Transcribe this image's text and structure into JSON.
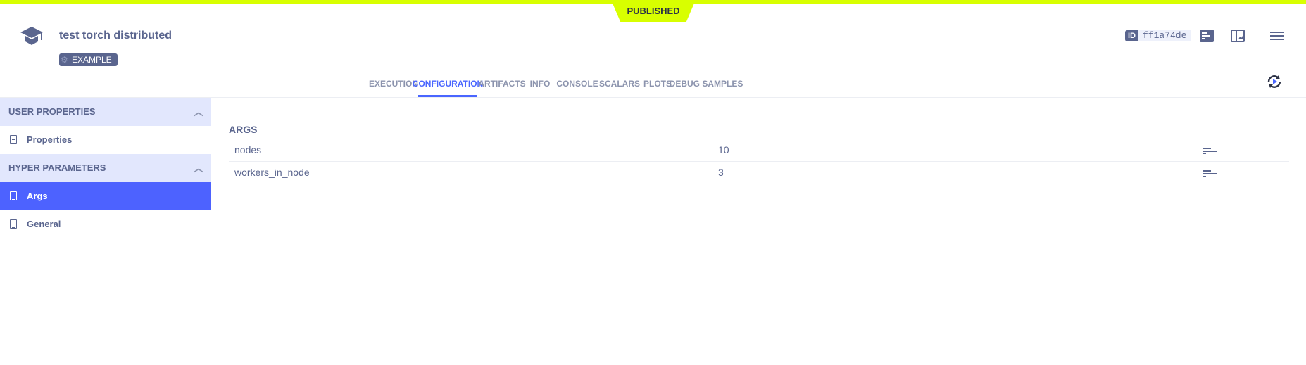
{
  "status_banner": "PUBLISHED",
  "header": {
    "title": "test torch distributed",
    "tag": "EXAMPLE",
    "id_label": "ID",
    "id_value": "ff1a74de",
    "icons": [
      "info-panel-icon",
      "details-layout-icon",
      "menu-icon"
    ]
  },
  "tabs": [
    {
      "label": "EXECUTION"
    },
    {
      "label": "CONFIGURATION",
      "active": true
    },
    {
      "label": "ARTIFACTS"
    },
    {
      "label": "INFO"
    },
    {
      "label": "CONSOLE"
    },
    {
      "label": "SCALARS"
    },
    {
      "label": "PLOTS"
    },
    {
      "label": "DEBUG SAMPLES"
    }
  ],
  "sidebar": {
    "sections": [
      {
        "title": "USER PROPERTIES",
        "items": [
          {
            "label": "Properties"
          }
        ]
      },
      {
        "title": "HYPER PARAMETERS",
        "items": [
          {
            "label": "Args",
            "active": true
          },
          {
            "label": "General"
          }
        ]
      }
    ]
  },
  "main": {
    "section_title": "ARGS",
    "rows": [
      {
        "key": "nodes",
        "value": "10"
      },
      {
        "key": "workers_in_node",
        "value": "3"
      }
    ]
  },
  "colors": {
    "accent": "#4a66ff",
    "banner": "#d8ff00",
    "text": "#5a658e"
  }
}
